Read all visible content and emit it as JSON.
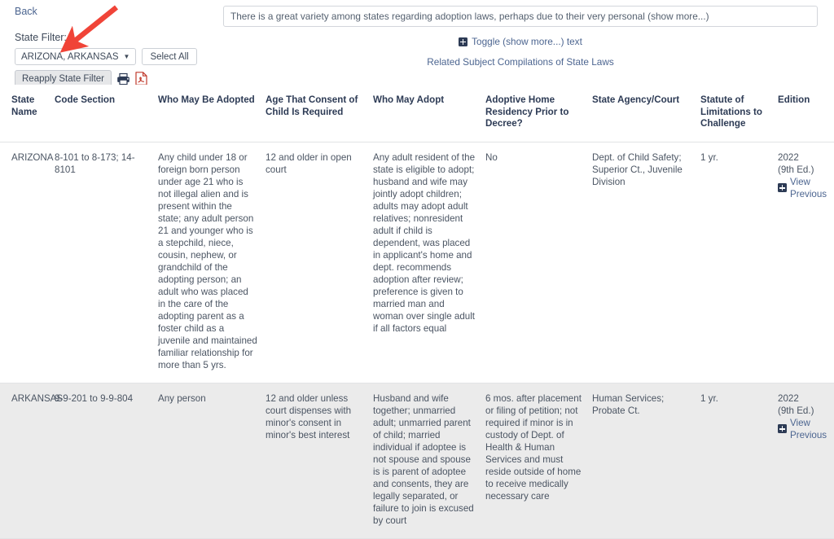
{
  "toolbar": {
    "back_label": "Back",
    "state_filter_label": "State Filter:",
    "state_filter_value": "ARIZONA, ARKANSAS",
    "state_filter_caret": "chevron-down-icon",
    "select_all_label": "Select All",
    "reapply_label": "Reapply State Filter",
    "print_icon": "printer-icon",
    "pdf_icon": "pdf-icon"
  },
  "notes": {
    "value": "There is a great variety among states regarding adoption laws, perhaps due to their very personal (show more...)",
    "placeholder": "There is a great variety among states regarding adoption laws, perhaps due to their very personal (show more...)"
  },
  "center": {
    "toggle_label": "Toggle (show more...) text",
    "toggle_icon": "plus-square-icon",
    "related_label": "Related Subject Compilations of State Laws"
  },
  "table": {
    "headers": [
      "State Name",
      "Code Section",
      "Who May Be Adopted",
      "Age That Consent of Child Is Required",
      "Who May Adopt",
      "Adoptive Home Residency Prior to Decree?",
      "State Agency/Court",
      "Statute of Limitations to Challenge",
      "Edition"
    ],
    "rows": [
      {
        "state_name": "ARIZONA",
        "code_section": "8-101 to 8-173; 14-8101",
        "who_may_be_adopted": "Any child under 18 or foreign born person under age 21 who is not illegal alien and is present within the state; any adult person 21 and younger who is a stepchild, niece, cousin, nephew, or grandchild of the adopting person; an adult who was placed in the care of the adopting parent as a foster child as a juvenile and maintained familiar relationship for more than 5 yrs.",
        "age_consent": "12 and older in open court",
        "who_may_adopt": "Any adult resident of the state is eligible to adopt; husband and wife may jointly adopt children; adults may adopt adult relatives; nonresident adult if child is dependent, was placed in applicant's home and dept. recommends adoption after review; preference is given to married man and woman over single adult if all factors equal",
        "residency": "No",
        "agency_court": "Dept. of Child Safety; Superior Ct., Juvenile Division",
        "statute_limitations": "1 yr.",
        "edition_year": "2022",
        "edition_ed": "(9th Ed.)",
        "edition_link": "View Previous",
        "edition_link_icon": "plus-square-icon"
      },
      {
        "state_name": "ARKANSAS",
        "code_section": "9-9-201 to 9-9-804",
        "who_may_be_adopted": "Any person",
        "age_consent": "12 and older unless court dispenses with minor's consent in minor's best interest",
        "who_may_adopt": "Husband and wife together; unmarried adult; unmarried parent of child; married individual if adoptee is not spouse and spouse is is parent of adoptee and consents, they are legally separated, or failure to join is excused by court",
        "residency": "6 mos. after placement or filing of petition; not required if minor is in custody of Dept. of Health & Human Services and must reside outside of home to receive medically necessary care",
        "agency_court": "Human Services; Probate Ct.",
        "statute_limitations": "1 yr.",
        "edition_year": "2022",
        "edition_ed": "(9th Ed.)",
        "edition_link": "View Previous",
        "edition_link_icon": "plus-square-icon"
      }
    ]
  },
  "annotation": {
    "arrow_color": "#f04438",
    "arrow_name": "red-pointer-arrow"
  }
}
